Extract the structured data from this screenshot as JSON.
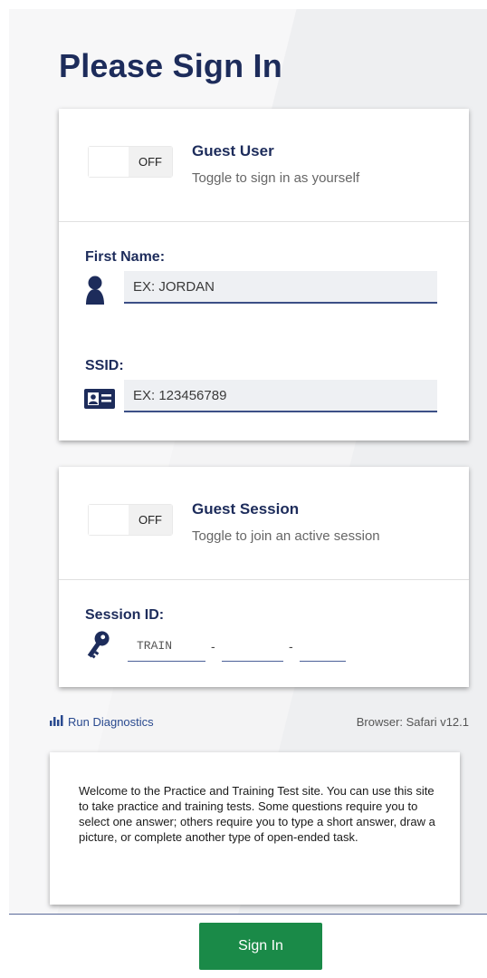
{
  "page": {
    "title": "Please Sign In"
  },
  "guest_user": {
    "toggle_state": "OFF",
    "title": "Guest User",
    "description": "Toggle to sign in as yourself"
  },
  "first_name": {
    "label": "First Name:",
    "placeholder": "EX: JORDAN",
    "value": "",
    "icon": "person-icon"
  },
  "ssid": {
    "label": "SSID:",
    "placeholder": "EX: 123456789",
    "value": "",
    "icon": "id-card-icon"
  },
  "guest_session": {
    "toggle_state": "OFF",
    "title": "Guest Session",
    "description": "Toggle to join an active session"
  },
  "session_id": {
    "label": "Session ID:",
    "icon": "key-icon",
    "part1_placeholder": "TRAIN",
    "part2_placeholder": "",
    "part3_placeholder": "",
    "separator": "-"
  },
  "diagnostics": {
    "label": "Run Diagnostics",
    "icon": "bar-chart-icon"
  },
  "browser": {
    "info": "Browser: Safari v12.1"
  },
  "welcome": {
    "text": "Welcome to the Practice and Training Test site. You can use this site to take practice and training tests. Some questions require you to select one answer; others require you to type a short answer, draw a picture, or complete another type of open-ended task."
  },
  "actions": {
    "sign_in_label": "Sign In"
  },
  "colors": {
    "heading": "#1d2c5b",
    "accent": "#3c4f86",
    "primary_button": "#1a8a48"
  }
}
